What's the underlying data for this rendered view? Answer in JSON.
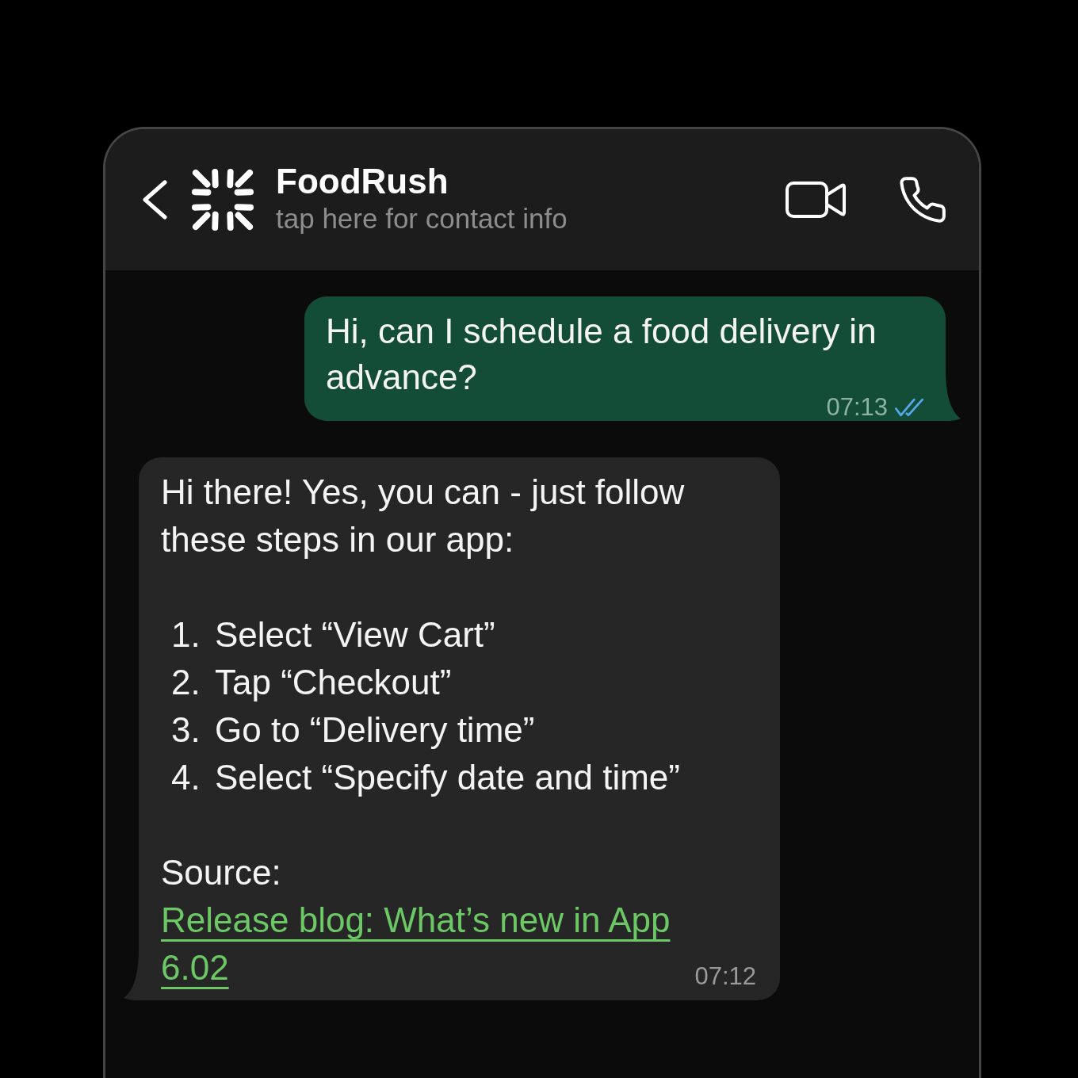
{
  "header": {
    "title": "FoodRush",
    "subtitle": "tap here for contact info"
  },
  "messages": [
    {
      "kind": "outgoing",
      "text": "Hi, can I schedule a food delivery in advance?",
      "time": "07:13",
      "read": true
    },
    {
      "kind": "incoming",
      "intro": "Hi there! Yes, you can - just follow these steps in our app:",
      "steps": [
        {
          "number": "1.",
          "text": "Select “View Cart”"
        },
        {
          "number": "2.",
          "text": "Tap “Checkout”"
        },
        {
          "number": "3.",
          "text": "Go to “Delivery time”"
        },
        {
          "number": "4.",
          "text": "Select “Specify date and time”"
        }
      ],
      "source_label": "Source:",
      "link": "Release blog: What’s new in App 6.02",
      "time": "07:12"
    }
  ]
}
